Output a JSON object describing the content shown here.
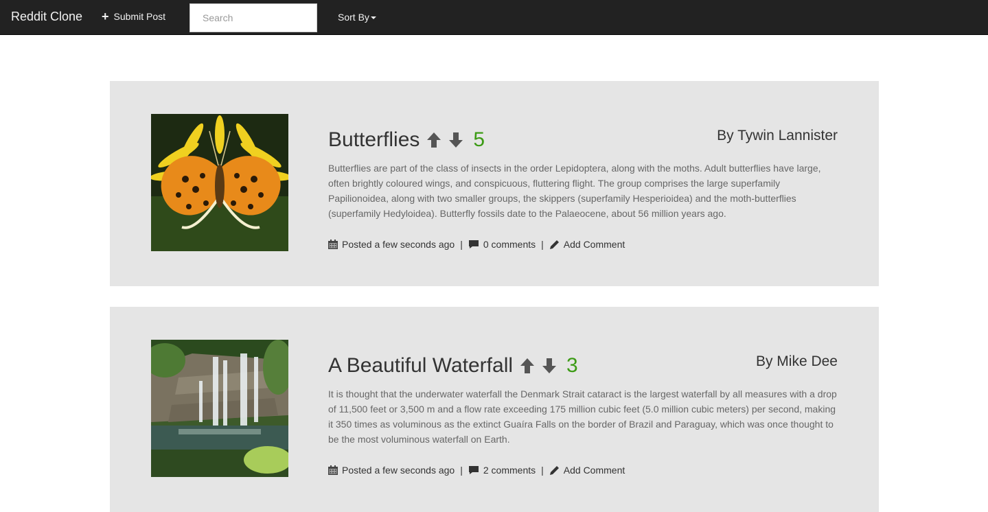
{
  "nav": {
    "brand": "Reddit Clone",
    "submit_label": "Submit Post",
    "search_placeholder": "Search",
    "sort_label": "Sort By"
  },
  "posts": [
    {
      "title": "Butterflies",
      "score": "5",
      "author": "By Tywin Lannister",
      "body": "Butterflies are part of the class of insects in the order Lepidoptera, along with the moths. Adult butterflies have large, often brightly coloured wings, and conspicuous, fluttering flight. The group comprises the large superfamily Papilionoidea, along with two smaller groups, the skippers (superfamily Hesperioidea) and the moth-butterflies (superfamily Hedyloidea). Butterfly fossils date to the Palaeocene, about 56 million years ago.",
      "posted": "Posted a few seconds ago",
      "comments": "0 comments",
      "add_comment": "Add Comment"
    },
    {
      "title": "A Beautiful Waterfall",
      "score": "3",
      "author": "By Mike Dee",
      "body": "It is thought that the underwater waterfall the Denmark Strait cataract is the largest waterfall by all measures with a drop of 11,500 feet or 3,500 m and a flow rate exceeding 175 million cubic feet (5.0 million cubic meters) per second, making it 350 times as voluminous as the extinct Guaíra Falls on the border of Brazil and Paraguay, which was once thought to be the most voluminous waterfall on Earth.",
      "posted": "Posted a few seconds ago",
      "comments": "2 comments",
      "add_comment": "Add Comment"
    }
  ],
  "colors": {
    "navbar": "#222222",
    "card": "#e5e5e5",
    "score": "#3c9b15"
  },
  "separator": "|"
}
